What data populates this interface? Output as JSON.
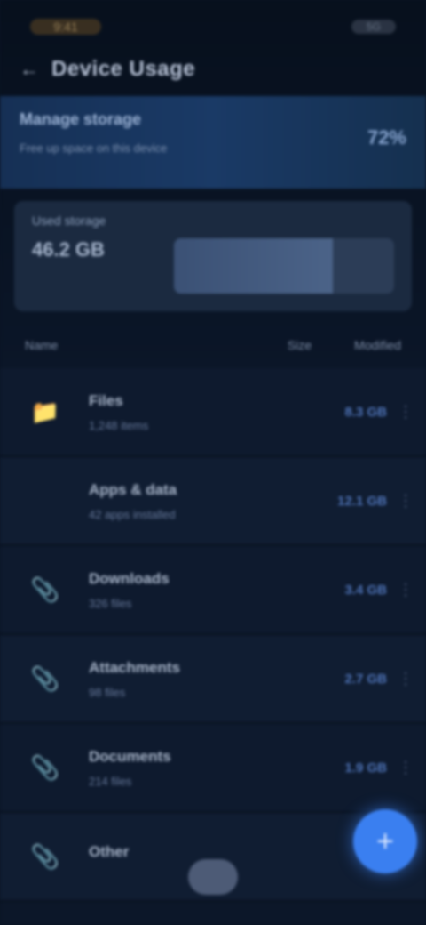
{
  "status_bar": {
    "time": "9:41",
    "icons": "5G"
  },
  "top_bar": {
    "title": "Device Usage"
  },
  "summary": {
    "title": "Manage storage",
    "subtitle": "Free up space on this device",
    "value": "72%"
  },
  "storage": {
    "label": "Used storage",
    "value": "46.2 GB",
    "used_fraction": 0.72
  },
  "list_header": {
    "left": "Name",
    "mid": "Size",
    "right": "Modified"
  },
  "rows": [
    {
      "icon": "folder-icon",
      "glyph": "📁",
      "name": "Files",
      "meta": "1,248 items",
      "size": "8.3 GB"
    },
    {
      "icon": "blank-icon",
      "glyph": "",
      "name": "Apps & data",
      "meta": "42 apps installed",
      "size": "12.1 GB"
    },
    {
      "icon": "paperclip-icon",
      "glyph": "📎",
      "name": "Downloads",
      "meta": "326 files",
      "size": "3.4 GB"
    },
    {
      "icon": "paperclip-icon",
      "glyph": "📎",
      "name": "Attachments",
      "meta": "98 files",
      "size": "2.7 GB"
    },
    {
      "icon": "paperclip-icon",
      "glyph": "📎",
      "name": "Documents",
      "meta": "214 files",
      "size": "1.9 GB"
    },
    {
      "icon": "paperclip-icon",
      "glyph": "📎",
      "name": "Other",
      "meta": "",
      "size": ""
    }
  ],
  "fab": {
    "glyph": "+"
  },
  "colors": {
    "accent": "#3a7ff0",
    "background": "#0a1424",
    "summary_bg": "#1a3a66"
  }
}
